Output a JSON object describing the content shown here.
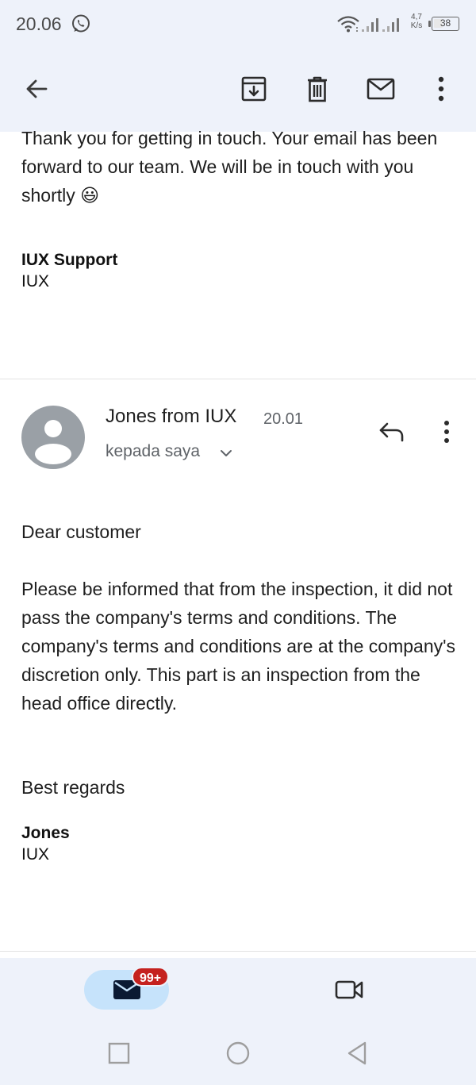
{
  "status_bar": {
    "time": "20.06",
    "net_speed_value": "4,7",
    "net_speed_unit": "K/s",
    "battery_level": "38",
    "battery_percent": 38
  },
  "toolbar": {
    "back_icon": "arrow-left-icon",
    "archive_icon": "archive-icon",
    "delete_icon": "trash-icon",
    "mark_unread_icon": "envelope-icon",
    "more_icon": "more-vertical-icon"
  },
  "previous_message": {
    "body": "Thank you for getting in touch. Your email has been forward to our team. We will be in touch with you shortly 😃",
    "signature_name": "IUX Support",
    "signature_org": "IUX"
  },
  "message": {
    "sender": "Jones from IUX",
    "time": "20.01",
    "recipient": "kepada saya",
    "greeting": "Dear customer",
    "body": "Please be informed that from the inspection, it did not pass the company's terms and conditions. The company's terms and conditions are at the company's discretion only. This part is an inspection from the head office directly.",
    "closing": "Best regards",
    "signature_name": "Jones",
    "signature_org": "IUX"
  },
  "bottom_nav": {
    "mail_badge": "99+",
    "mail_icon": "mail-icon",
    "meet_icon": "video-camera-icon"
  },
  "colors": {
    "chrome_bg": "#eef2fa",
    "active_pill": "#c6e3fb",
    "badge_red": "#c5221f",
    "avatar_gray": "#9aa0a6"
  }
}
